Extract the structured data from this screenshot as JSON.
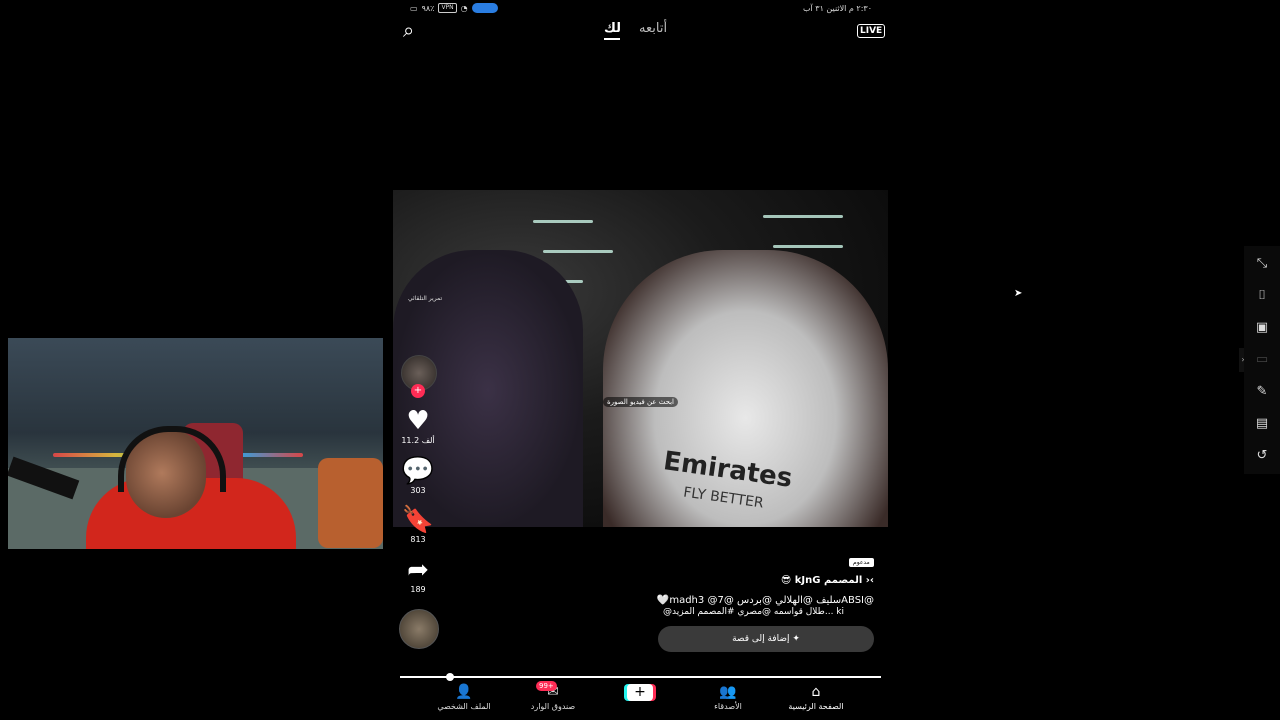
{
  "status_bar": {
    "time_date": "٢:٣٠ م الاثنين ٣١ آب",
    "battery": "٩٨٪",
    "vpn": "VPN"
  },
  "top_nav": {
    "live_label": "LIVE",
    "tab_following": "أتابعه",
    "tab_for_you": "لك"
  },
  "video": {
    "jersey_text": "Emirates",
    "jersey_sub": "FLY BETTER",
    "search_hint": "ابحث عن فيديو الصورة"
  },
  "side_actions": {
    "live_hint": "تمرير التلقائي",
    "follow": "+",
    "likes": "11.2 ألف",
    "comments": "303",
    "saves": "813",
    "shares": "189"
  },
  "caption": {
    "sponsored": "مدعوم",
    "author": "😎 kJnG المصمم ›‹",
    "line1": "🤍madhسليف @الهلالي @بردس @7@ 3ABSI@",
    "line2": "@طلال قواسمه @مصري #المصمم المزيد... ki"
  },
  "story_button": "إضافة إلى قصة ✦",
  "progress": {
    "played_fraction": 0.1
  },
  "bottom_nav": {
    "profile": "الملف الشخصي",
    "inbox": "صندوق الوارد",
    "inbox_badge": "99+",
    "create": "+",
    "friends": "الأصدقاء",
    "home": "الصفحة الرئيسية"
  },
  "icons": {
    "search": "search-icon",
    "live": "live-icon",
    "heart": "heart-icon",
    "comment": "comment-icon",
    "bookmark": "bookmark-icon",
    "share": "share-icon"
  },
  "colors": {
    "accent_red": "#fe2c55",
    "accent_cyan": "#25f4ee",
    "status_blue": "#2a7de1"
  }
}
